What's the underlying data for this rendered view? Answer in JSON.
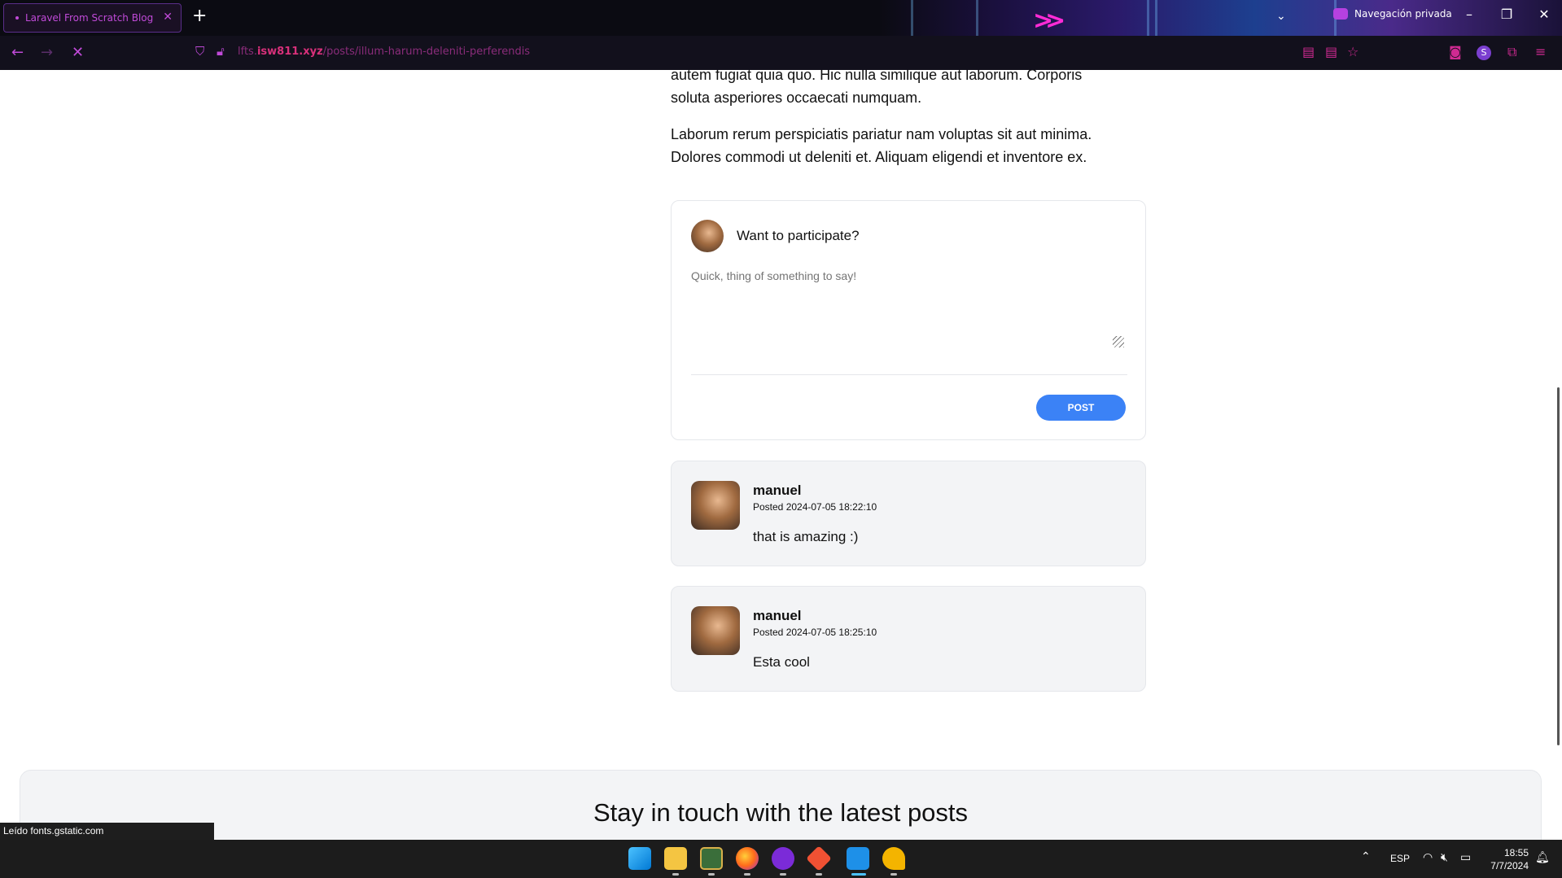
{
  "browser": {
    "tab_title": "Laravel From Scratch Blog",
    "tab_close": "✕",
    "new_tab": "+",
    "private_label": "Navegación privada",
    "url_prefix": "lfts.",
    "url_domain": "isw811.xyz",
    "url_path": "/posts/illum-harum-deleniti-perferendis",
    "profile_initial": "S",
    "status_text": "Leído fonts.gstatic.com"
  },
  "article": {
    "para1_line1": "autem fugiat quia quo. Hic nulla similique aut laborum. Corporis",
    "para1_line2": "soluta asperiores occaecati numquam.",
    "para2_line1": "Laborum rerum perspiciatis pariatur nam voluptas sit aut minima.",
    "para2_line2": "Dolores commodi ut deleniti et. Aliquam eligendi et inventore ex."
  },
  "comment_form": {
    "title": "Want to participate?",
    "placeholder": "Quick, thing of something to say!",
    "submit_label": "POST"
  },
  "comments": [
    {
      "author": "manuel",
      "posted": "Posted 2024-07-05 18:22:10",
      "body": "that is amazing :)"
    },
    {
      "author": "manuel",
      "posted": "Posted 2024-07-05 18:25:10",
      "body": "Esta cool"
    }
  ],
  "newsletter": {
    "heading": "Stay in touch with the latest posts"
  },
  "taskbar": {
    "language": "ESP",
    "time": "18:55",
    "date": "7/7/2024"
  },
  "colors": {
    "accent": "#3b82f6",
    "chrome_accent": "#c04ad8"
  }
}
